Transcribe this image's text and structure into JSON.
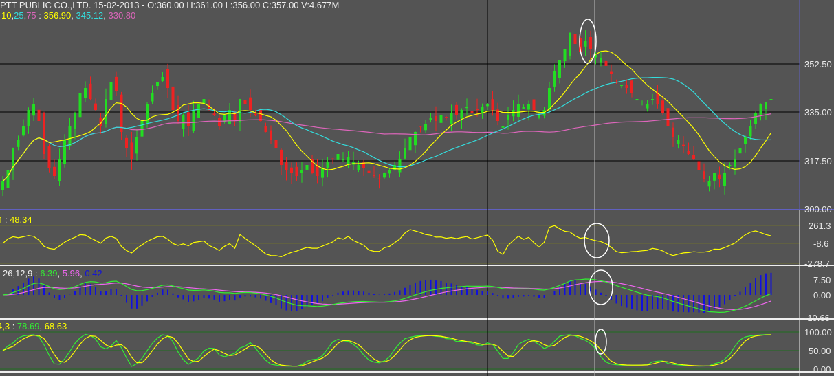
{
  "header": {
    "title": "PTT PUBLIC CO.,LTD. 15-02-2013 - O:360.00 H:361.00 L:356.00 C:357.00 V:4.677M",
    "ma_periods": [
      "10",
      "25",
      "75"
    ],
    "ma_values": [
      "356.90",
      "345.12",
      "330.80"
    ],
    "ma_colors": [
      "#ffff00",
      "#33dddd",
      "#dd66bb"
    ]
  },
  "panels": {
    "osc": {
      "label": "4",
      "value": "48.34",
      "ticks": [
        "261.3",
        "-8.6",
        "-278.7"
      ]
    },
    "macd": {
      "label": "26,12,9",
      "values": [
        "6.39",
        "5.96",
        "0.42"
      ],
      "colors": [
        "#33ee33",
        "#ee66ee",
        "#1111dd"
      ],
      "ticks": [
        "7.50",
        "0.00",
        "-10.66"
      ]
    },
    "stoch": {
      "label": "4,3",
      "values": [
        "78.69",
        "68.63"
      ],
      "colors": [
        "#33ee33",
        "#ffff00"
      ],
      "ticks": [
        "100.00",
        "50.00",
        "0.00"
      ]
    }
  },
  "chart_data": {
    "type": "candlestick",
    "price_ticks": [
      "352.50",
      "335.00",
      "317.50",
      "300.00"
    ],
    "ylim": [
      300,
      376
    ],
    "up_color": "#22dd22",
    "down_color": "#ee2222",
    "close": [
      310,
      314,
      322,
      325,
      330,
      336,
      338,
      332,
      320,
      315,
      312,
      318,
      325,
      330,
      335,
      342,
      344,
      340,
      336,
      330,
      340,
      346,
      343,
      328,
      322,
      318,
      326,
      332,
      338,
      342,
      346,
      348,
      344,
      336,
      332,
      334,
      330,
      336,
      338,
      340,
      336,
      334,
      330,
      334,
      336,
      332,
      340,
      338,
      336,
      334,
      332,
      328,
      325,
      322,
      316,
      314,
      313,
      312,
      314,
      316,
      313,
      312,
      315,
      317,
      318,
      320,
      318,
      319,
      317,
      316,
      315,
      313,
      312,
      311,
      313,
      314,
      316,
      318,
      322,
      326,
      328,
      330,
      331,
      333,
      332,
      334,
      333,
      335,
      334,
      336,
      337,
      335,
      336,
      337,
      338,
      336,
      332,
      330,
      334,
      336,
      338,
      337,
      338,
      336,
      334,
      336,
      344,
      350,
      354,
      358,
      364,
      360,
      357,
      361,
      358,
      356,
      355,
      352,
      349,
      346,
      345,
      344,
      342,
      340,
      339,
      338,
      340,
      338,
      335,
      330,
      326,
      325,
      323,
      320,
      318,
      314,
      311,
      310,
      313,
      311,
      313,
      316,
      318,
      322,
      326,
      330,
      335,
      338,
      339,
      340
    ]
  }
}
